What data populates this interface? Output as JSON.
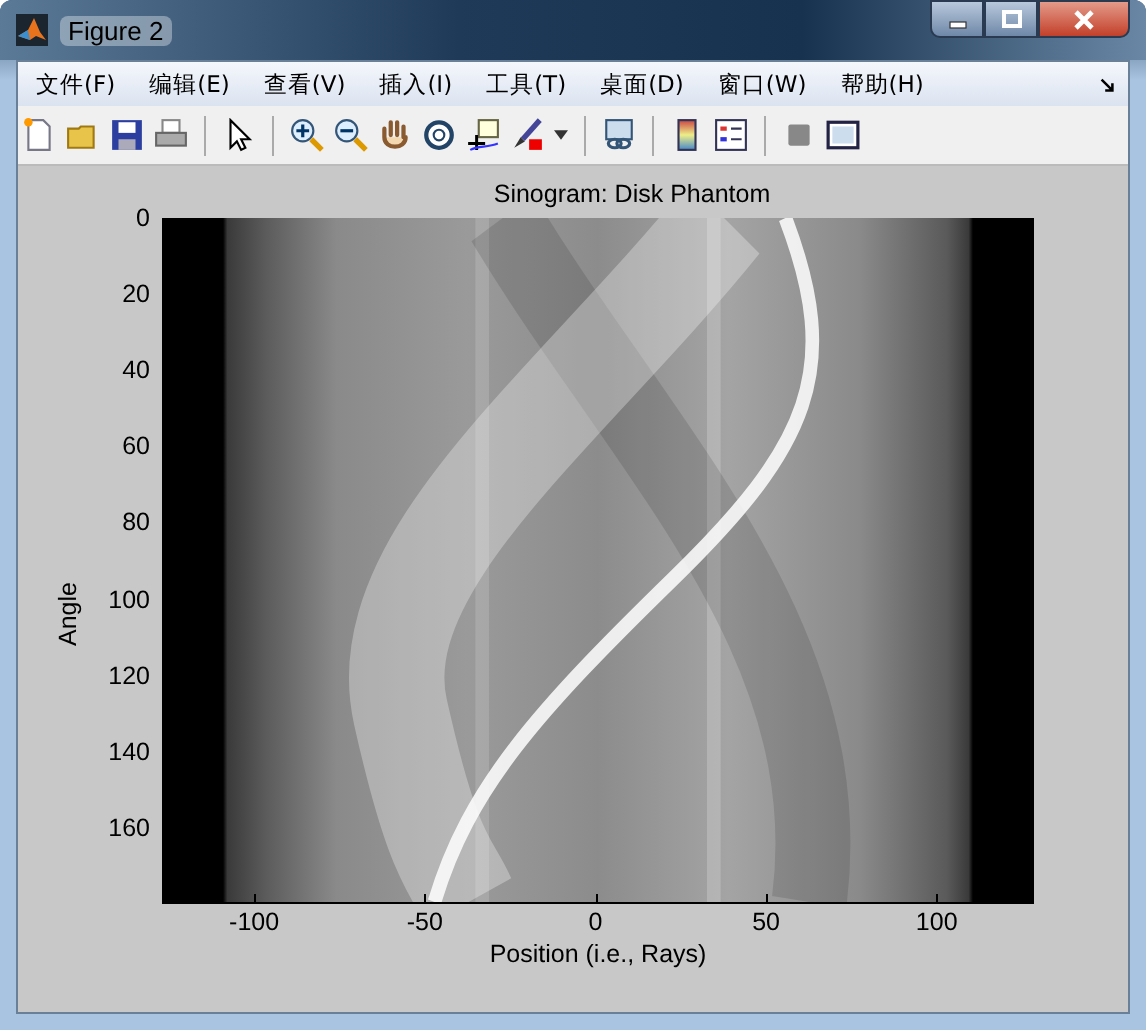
{
  "window": {
    "title": "Figure 2"
  },
  "menu": [
    "文件(F)",
    "编辑(E)",
    "查看(V)",
    "插入(I)",
    "工具(T)",
    "桌面(D)",
    "窗口(W)",
    "帮助(H)"
  ],
  "axes": {
    "title": "Sinogram: Disk Phantom",
    "ylabel": "Angle",
    "xlabel": "Position (i.e., Rays)",
    "yticks": [
      "0",
      "20",
      "40",
      "60",
      "80",
      "100",
      "120",
      "140",
      "160"
    ],
    "xticks": [
      "-100",
      "-50",
      "0",
      "50",
      "100"
    ]
  }
}
